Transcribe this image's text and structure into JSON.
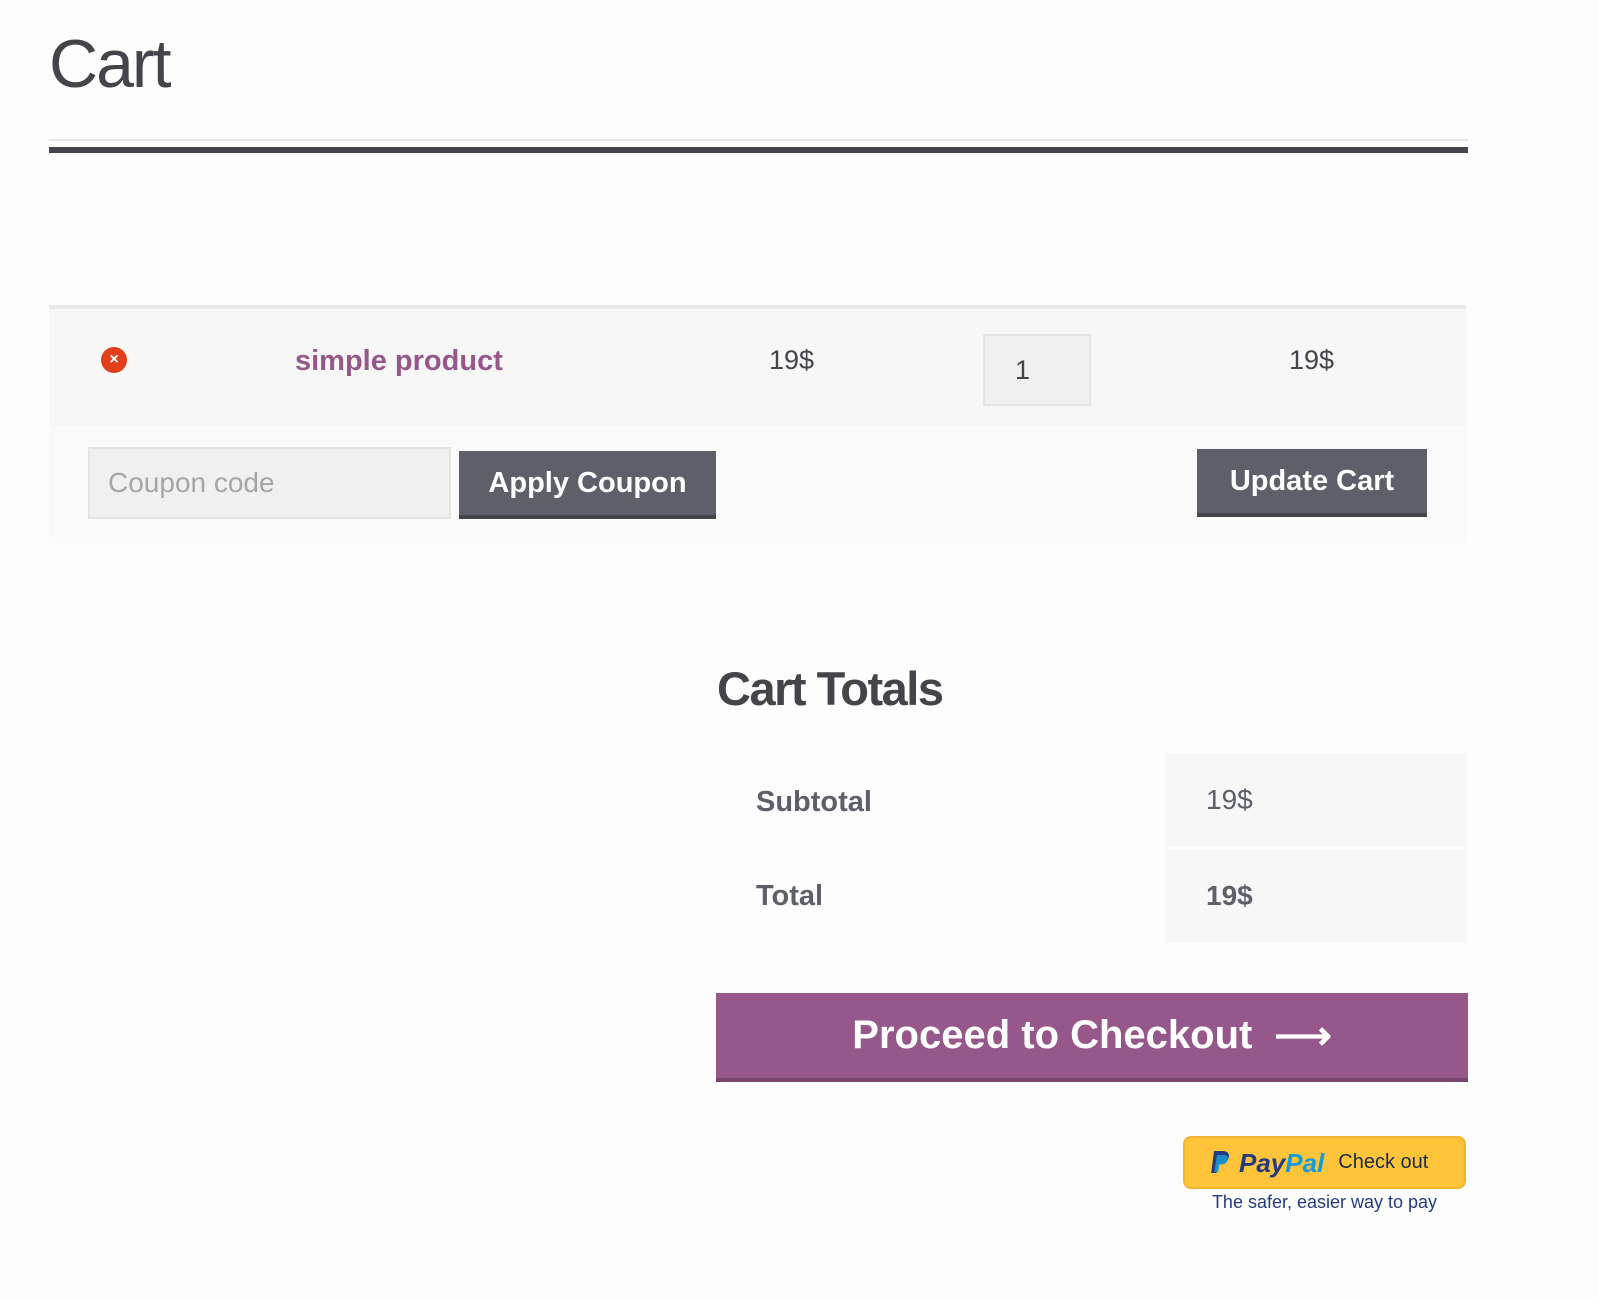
{
  "page": {
    "title": "Cart"
  },
  "cart": {
    "items": [
      {
        "remove_icon": "×",
        "name": "simple product",
        "price": "19$",
        "quantity": "1",
        "subtotal": "19$"
      }
    ],
    "coupon": {
      "placeholder": "Coupon code",
      "apply_label": "Apply Coupon"
    },
    "update_label": "Update Cart"
  },
  "totals": {
    "heading": "Cart Totals",
    "subtotal_label": "Subtotal",
    "subtotal_value": "19$",
    "total_label": "Total",
    "total_value": "19$"
  },
  "checkout": {
    "label": "Proceed to Checkout",
    "arrow": "⟶"
  },
  "paypal": {
    "pay": "Pay",
    "pal": "Pal",
    "checkout_label": "Check out",
    "tagline": "The safer, easier way to pay"
  },
  "colors": {
    "accent": "#96588a",
    "button_dark": "#5d6069",
    "remove": "#e2401c",
    "paypal_yellow": "#ffc439",
    "paypal_blue": "#253b80"
  },
  "icons": {
    "remove": "remove-circle-icon",
    "arrow": "arrow-right-icon",
    "paypal": "paypal-logo-icon"
  }
}
